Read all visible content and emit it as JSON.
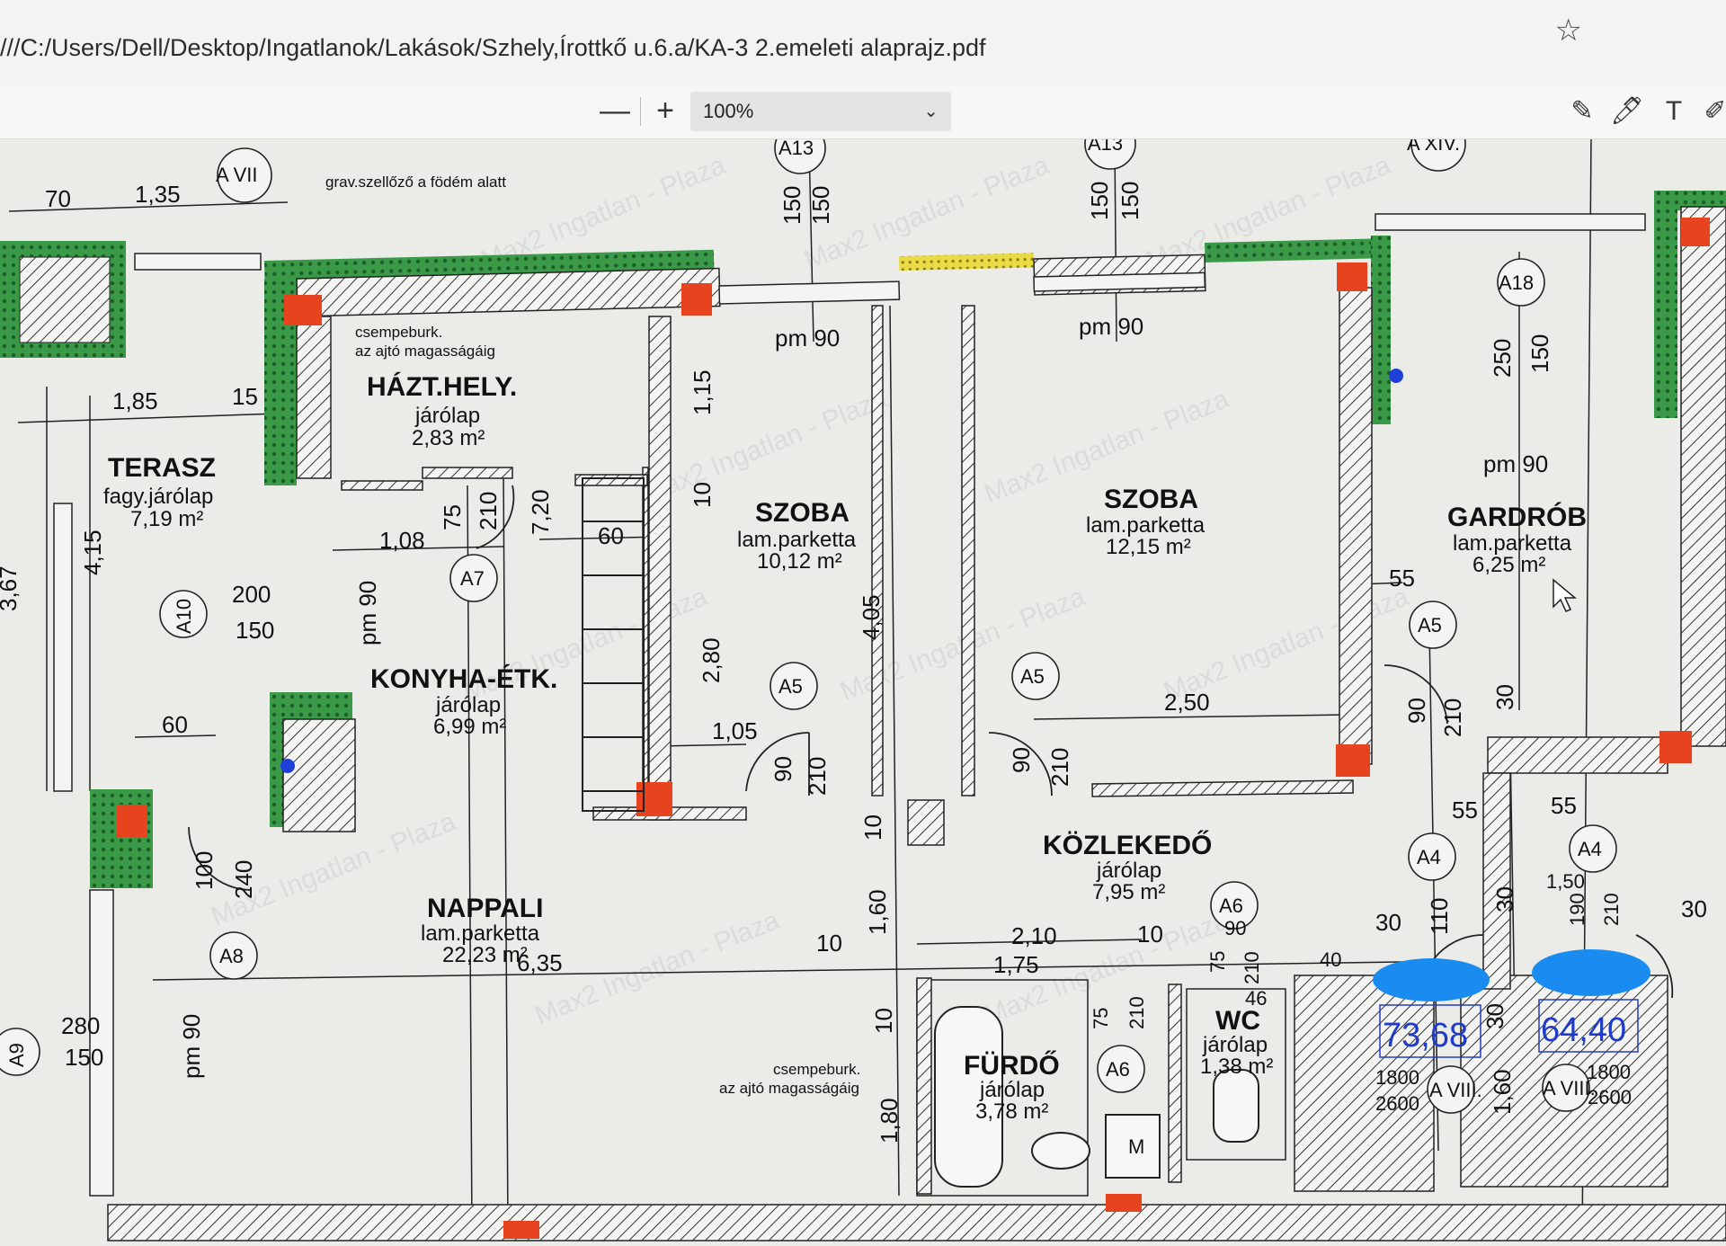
{
  "browser": {
    "url": "///C:/Users/Dell/Desktop/Ingatlanok/Lakások/Szhely,Írottkő u.6.a/KA-3 2.emeleti alaprajz.pdf"
  },
  "pdf_toolbar": {
    "zoom_out": "—",
    "zoom_in": "+",
    "zoom_value": "100%"
  },
  "plan": {
    "rooms": {
      "terasz": {
        "name": "TERASZ",
        "finish": "fagy.járólap",
        "area": "7,19 m²"
      },
      "haztartasi": {
        "name": "HÁZT.HELY.",
        "finish": "járólap",
        "area": "2,83 m²"
      },
      "szoba1": {
        "name": "SZOBA",
        "finish": "lam.parketta",
        "area": "10,12 m²"
      },
      "szoba2": {
        "name": "SZOBA",
        "finish": "lam.parketta",
        "area": "12,15 m²"
      },
      "gardrob": {
        "name": "GARDRÓB",
        "finish": "lam.parketta",
        "area": "6,25 m²"
      },
      "konyha": {
        "name": "KONYHA-ÉTK.",
        "finish": "járólap",
        "area": "6,99 m²"
      },
      "kozlekedo": {
        "name": "KÖZLEKEDŐ",
        "finish": "járólap",
        "area": "7,95 m²"
      },
      "nappali": {
        "name": "NAPPALI",
        "finish": "lam.parketta",
        "area": "22,23 m²"
      },
      "furdo": {
        "name": "FÜRDŐ",
        "finish": "járólap",
        "area": "3,78 m²"
      },
      "wc": {
        "name": "WC",
        "finish": "járólap",
        "area": "1,38 m²"
      }
    },
    "notes": {
      "grav": "grav.szellőző a födém alatt",
      "csempe1a": "csempeburk.",
      "csempe1b": "az ajtó magasságáig",
      "csempe2a": "csempeburk.",
      "csempe2b": "az ajtó magasságáig"
    },
    "tags": {
      "avii": "A VII",
      "a13a": "A13",
      "a13b": "A13",
      "axiv": "A XIV.",
      "a18": "A18",
      "a7": "A7",
      "a10": "A10",
      "a5a": "A5",
      "a5b": "A5",
      "a5c": "A5",
      "a4a": "A4",
      "a4b": "A4",
      "a6a": "A6",
      "a6b": "A6",
      "a8": "A8",
      "a9": "A9",
      "aviii1": "A VIII.",
      "aviii2": "A VIII."
    },
    "dims": {
      "d70": "70",
      "d135": "1,35",
      "d150a": "150",
      "d150b": "150",
      "d150c": "150",
      "d150d": "150",
      "pm90a": "pm 90",
      "pm90b": "pm 90",
      "pm90c": "pm 90",
      "pm90d": "pm 90",
      "pm90e": "pm 90",
      "d185": "1,85",
      "d15": "15",
      "d415": "4,15",
      "d367": "3,67",
      "d200": "200",
      "d150e": "150",
      "d60a": "60",
      "d108": "1,08",
      "d75a": "75",
      "d210a": "210",
      "d720": "7,20",
      "d60b": "60",
      "d115": "1,15",
      "d10a": "10",
      "d280": "2,80",
      "d405": "4,05",
      "d105": "1,05",
      "d90a": "90",
      "d210b": "210",
      "d90b": "90",
      "d210c": "210",
      "d250": "2,50",
      "d250b": "250",
      "d150f": "150",
      "d55a": "55",
      "d90c": "90",
      "d210d": "210",
      "d30a": "30",
      "d55b": "55",
      "d55c": "55",
      "d150g": "1,50",
      "d190": "190",
      "d210e": "210",
      "d30b": "30",
      "d100": "100",
      "d240": "240",
      "d10b": "10",
      "d160": "1,60",
      "d10c": "10",
      "d210f": "2,10",
      "d175": "1,75",
      "d10d": "10",
      "d90d": "90",
      "d75b": "75",
      "d210g": "210",
      "d46": "46",
      "d40": "40",
      "d30c": "30",
      "d110": "110",
      "d30d": "30",
      "d30e": "30",
      "d635": "6,35",
      "d280b": "280",
      "d150h": "150",
      "d10e": "10",
      "d180": "1,80",
      "d75c": "75",
      "d210h": "210",
      "d160b": "1,60",
      "d1800a": "1800",
      "d2600a": "2600",
      "d1800b": "1800",
      "d2600b": "2600",
      "m": "M"
    },
    "boxes": {
      "left": "73,68",
      "right": "64,40"
    },
    "watermark": "Max2 Ingatlan - Plaza"
  },
  "colors": {
    "wall_green": "#2f8a3a",
    "column_red": "#e8431f",
    "window_yellow": "#e8d83a",
    "area_blue": "#1f3cc8",
    "redaction_blue": "#1a8cf0"
  }
}
